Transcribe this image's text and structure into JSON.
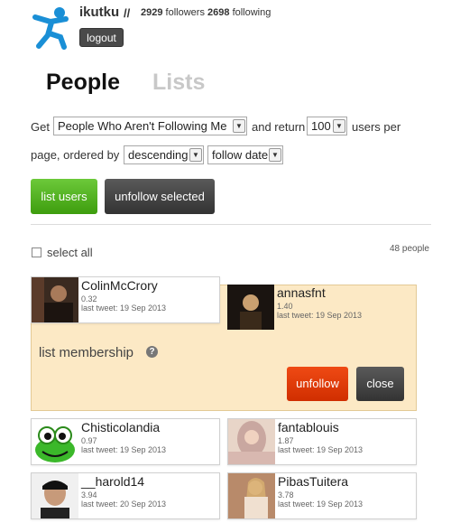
{
  "header": {
    "username": "ikutku",
    "separator": "//",
    "followers_count": "2929",
    "followers_label": "followers",
    "following_count": "2698",
    "following_label": "following",
    "logout_label": "logout"
  },
  "tabs": [
    {
      "label": "People",
      "active": true
    },
    {
      "label": "Lists",
      "active": false
    }
  ],
  "query": {
    "get_label": "Get",
    "filter_value": "People Who Aren't Following Me",
    "and_return_label": "and return",
    "limit_value": "100",
    "users_per_label": "users per",
    "page_ordered_label": "page, ordered by",
    "order_value": "descending",
    "sort_value": "follow date"
  },
  "actions": {
    "list_users_label": "list users",
    "unfollow_selected_label": "unfollow selected"
  },
  "select_all_label": "select all",
  "people_count": "48 people",
  "users": [
    {
      "name": "ColinMcCrory",
      "ratio": "0.32",
      "last_tweet": "last tweet: 19 Sep 2013"
    },
    {
      "name": "annasfnt",
      "ratio": "1.40",
      "last_tweet": "last tweet: 19 Sep 2013"
    },
    {
      "name": "Chisticolandia",
      "ratio": "0.97",
      "last_tweet": "last tweet: 19 Sep 2013"
    },
    {
      "name": "fantablouis",
      "ratio": "1.87",
      "last_tweet": "last tweet: 19 Sep 2013"
    },
    {
      "name": "__harold14",
      "ratio": "3.94",
      "last_tweet": "last tweet: 20 Sep 2013"
    },
    {
      "name": "PibasTuitera",
      "ratio": "3.78",
      "last_tweet": "last tweet: 19 Sep 2013"
    }
  ],
  "panel": {
    "membership_label": "list membership",
    "help_glyph": "?",
    "unfollow_label": "unfollow",
    "close_label": "close"
  },
  "colors": {
    "accent_green": "#4cae18",
    "accent_red": "#e03a08",
    "panel_bg": "#fce9c5",
    "brand_blue": "#1a8fd6"
  }
}
